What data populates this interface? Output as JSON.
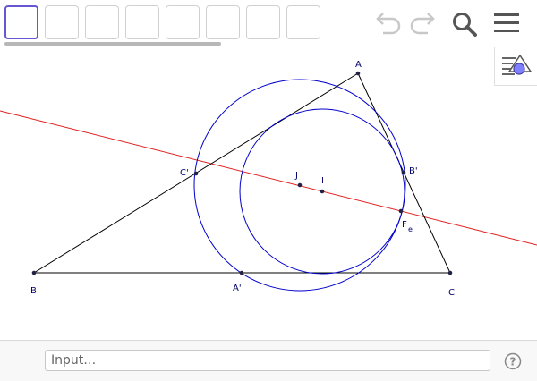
{
  "toolbar": {
    "tool_slots": [
      "tool-slot-1",
      "tool-slot-2",
      "tool-slot-3",
      "tool-slot-4",
      "tool-slot-5",
      "tool-slot-6",
      "tool-slot-7",
      "tool-slot-8"
    ],
    "active_slot": 0,
    "icons": [
      "undo-icon",
      "redo-icon",
      "search-icon",
      "menu-icon"
    ]
  },
  "side_panel": {
    "icon": "algebra-view-toggle-icon"
  },
  "geometry": {
    "labels": {
      "A": "A",
      "B": "B",
      "C": "C",
      "A_prime": "A'",
      "B_prime": "B'",
      "C_prime": "C'",
      "I": "I",
      "J": "J",
      "F": "F",
      "F_sub": "e"
    },
    "colors": {
      "triangle": "#000000",
      "circles": "#0000cc",
      "line": "#e02020",
      "points": "#222244"
    }
  },
  "input_bar": {
    "placeholder": "Input…"
  },
  "help": {
    "icon": "help-icon",
    "symbol": "?"
  }
}
